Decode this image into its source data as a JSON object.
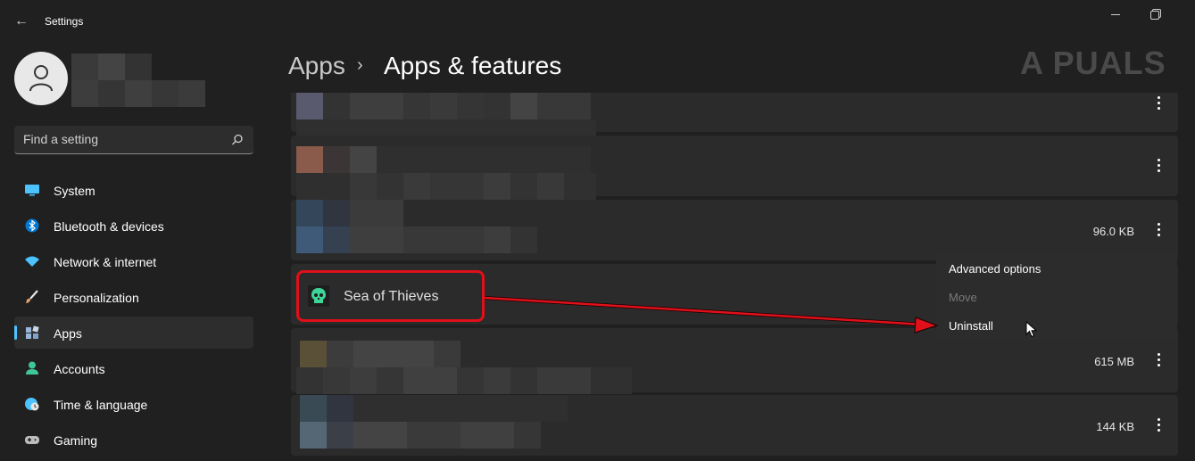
{
  "window": {
    "title": "Settings",
    "back_icon": "back-arrow-icon"
  },
  "search": {
    "placeholder": "Find a setting"
  },
  "sidebar": {
    "items": [
      {
        "label": "System",
        "icon": "system-display-icon",
        "color": "#4cc2ff"
      },
      {
        "label": "Bluetooth & devices",
        "icon": "bluetooth-icon",
        "color": "#0078d4"
      },
      {
        "label": "Network & internet",
        "icon": "wifi-icon",
        "color": "#4cc2ff"
      },
      {
        "label": "Personalization",
        "icon": "paintbrush-icon",
        "color": "#e8a36a"
      },
      {
        "label": "Apps",
        "icon": "apps-icon",
        "color": "#9ab6d8"
      },
      {
        "label": "Accounts",
        "icon": "person-icon",
        "color": "#3fc59a"
      },
      {
        "label": "Time & language",
        "icon": "globe-clock-icon",
        "color": "#4cc2ff"
      },
      {
        "label": "Gaming",
        "icon": "gamepad-icon",
        "color": "#bcbcbc"
      }
    ],
    "active_index": 4
  },
  "header": {
    "breadcrumb_parent": "Apps",
    "separator": "›",
    "title": "Apps & features"
  },
  "watermark": "A  PUALS",
  "apps": [
    {
      "name": "",
      "size": "",
      "redacted": true
    },
    {
      "name": "",
      "size": "",
      "redacted": true
    },
    {
      "name": "",
      "size": "96.0 KB",
      "redacted": true
    },
    {
      "name": "Sea of Thieves",
      "size": "",
      "redacted": false
    },
    {
      "name": "",
      "size": "615 MB",
      "redacted": true
    },
    {
      "name": "",
      "size": "144 KB",
      "redacted": true
    }
  ],
  "context_menu": {
    "items": [
      {
        "label": "Advanced options",
        "enabled": true
      },
      {
        "label": "Move",
        "enabled": false
      },
      {
        "label": "Uninstall",
        "enabled": true
      }
    ]
  },
  "colors": {
    "accent": "#4cc2ff",
    "annotation_red": "#e0101a",
    "background": "#202020",
    "card": "#2b2b2b"
  }
}
